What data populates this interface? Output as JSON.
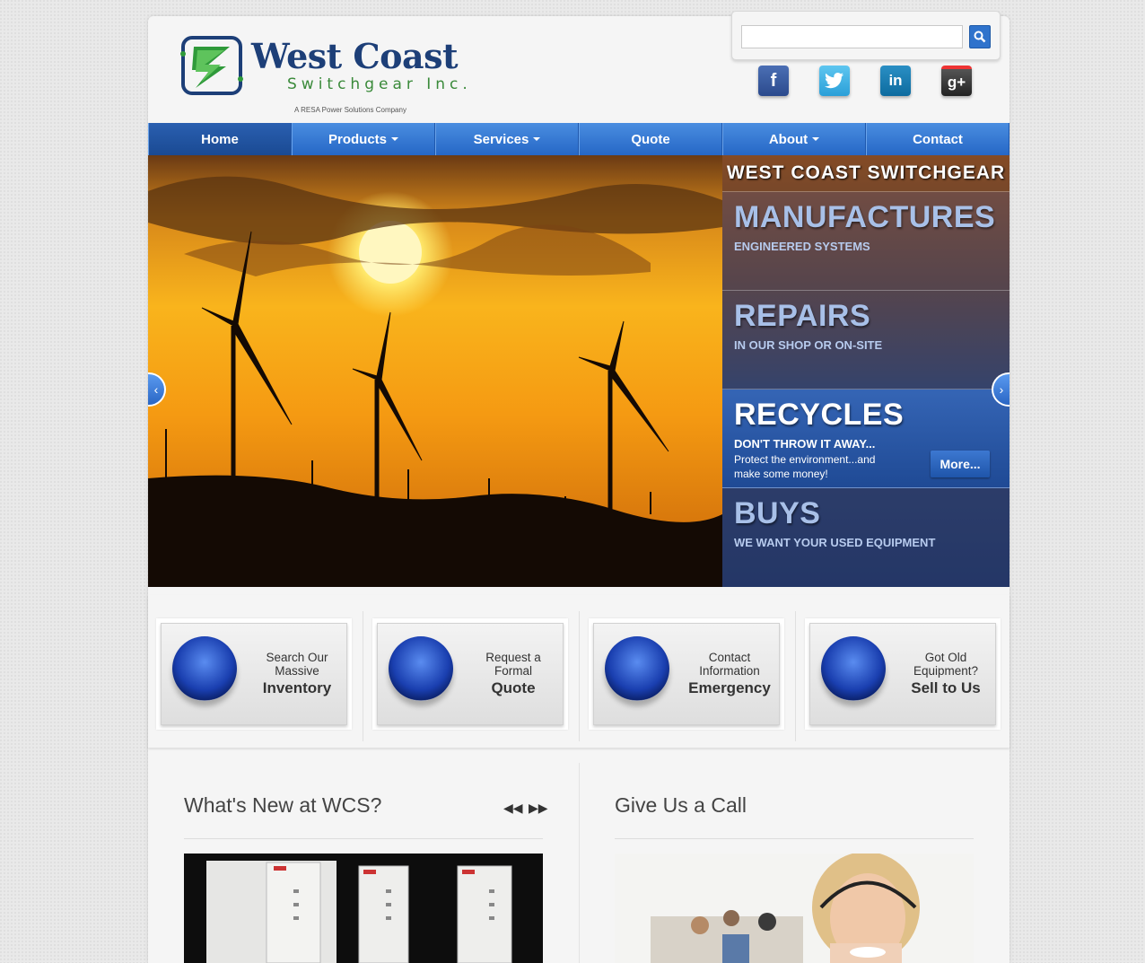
{
  "header": {
    "logo_title": "West Coast",
    "logo_subtitle": "Switchgear Inc.",
    "logo_tagline": "A RESA Power Solutions Company",
    "search_placeholder": "",
    "social": [
      "facebook-icon",
      "twitter-icon",
      "linkedin-icon",
      "google-plus-icon"
    ]
  },
  "nav": {
    "items": [
      {
        "label": "Home",
        "active": true,
        "dropdown": false
      },
      {
        "label": "Products",
        "dropdown": true
      },
      {
        "label": "Services",
        "dropdown": true
      },
      {
        "label": "Quote",
        "dropdown": false
      },
      {
        "label": "About",
        "dropdown": true
      },
      {
        "label": "Contact",
        "dropdown": false
      }
    ]
  },
  "hero": {
    "panel_heading": "WEST COAST SWITCHGEAR",
    "rows": [
      {
        "title": "MANUFACTURES",
        "subtitle": "ENGINEERED SYSTEMS"
      },
      {
        "title": "REPAIRS",
        "subtitle": "IN OUR SHOP OR ON-SITE"
      },
      {
        "title": "RECYCLES",
        "subtitle": "DON'T THROW IT AWAY...",
        "description": "Protect the environment...and make some money!",
        "button": "More..."
      },
      {
        "title": "BUYS",
        "subtitle": "WE WANT YOUR USED EQUIPMENT"
      }
    ]
  },
  "features": [
    {
      "line1": "Search Our",
      "line2": "Massive",
      "bold": "Inventory",
      "icon": "box-icon"
    },
    {
      "line1": "Request a",
      "line2": "Formal",
      "bold": "Quote",
      "icon": "documents-icon"
    },
    {
      "line1": "Contact",
      "line2": "Information",
      "bold": "Emergency",
      "icon": "medical-cross-icon"
    },
    {
      "line1": "Got Old",
      "line2": "Equipment?",
      "bold": "Sell to Us",
      "icon": "dollar-icon"
    }
  ],
  "lower": {
    "news_title": "What's New at WCS?",
    "call_title": "Give Us a Call"
  },
  "colors": {
    "nav_blue": "#2f73cc",
    "brand_navy": "#1d3f78",
    "brand_green": "#3a8a3a"
  }
}
